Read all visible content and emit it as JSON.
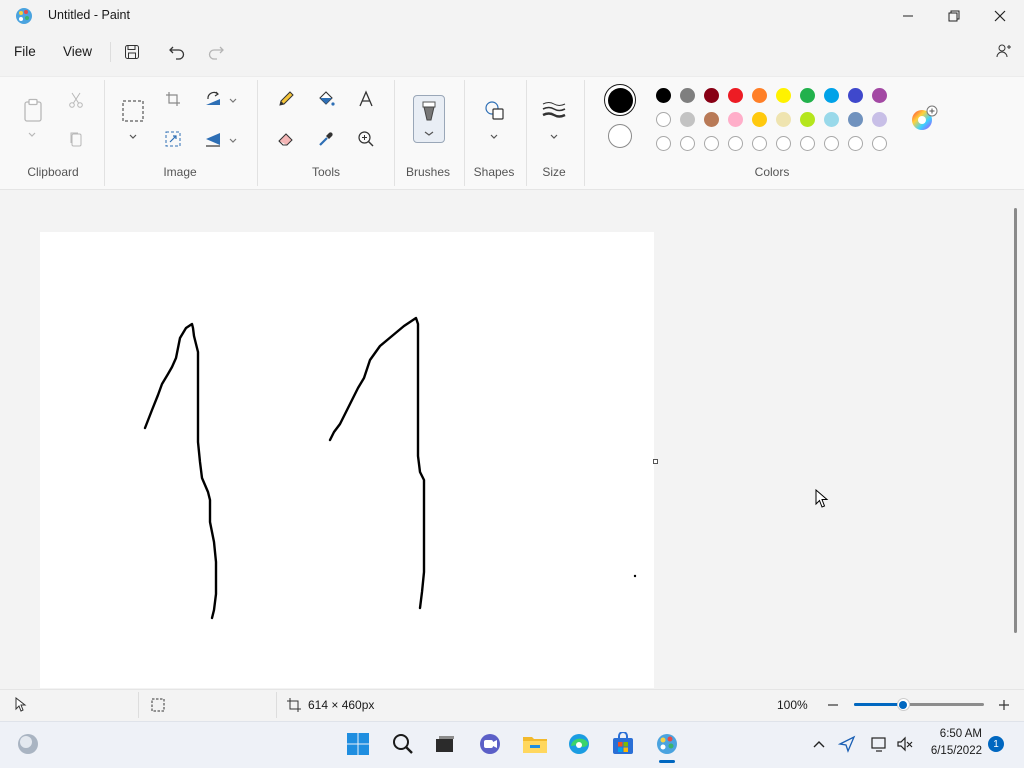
{
  "window": {
    "title": "Untitled - Paint"
  },
  "menu": {
    "file": "File",
    "view": "View"
  },
  "ribbon": {
    "groups": {
      "clipboard": "Clipboard",
      "image": "Image",
      "tools": "Tools",
      "brushes": "Brushes",
      "shapes": "Shapes",
      "size": "Size",
      "colors": "Colors"
    }
  },
  "colors": {
    "primary": "#000000",
    "secondary": "#ffffff",
    "palette_row1": [
      "#000000",
      "#7f7f7f",
      "#880015",
      "#ed1c24",
      "#ff7f27",
      "#fff200",
      "#22b14c",
      "#00a2e8",
      "#3f48cc",
      "#a349a4"
    ],
    "palette_row2": [
      "#ffffff",
      "#c3c3c3",
      "#b97a57",
      "#ffaec9",
      "#ffc90e",
      "#efe4b0",
      "#b5e61d",
      "#99d9ea",
      "#7092be",
      "#c8bfe7"
    ]
  },
  "status": {
    "canvas_size": "614 × 460px",
    "zoom": "100%",
    "zoom_level": 0.38
  },
  "taskbar": {
    "time": "6:50 AM",
    "date": "6/15/2022",
    "notification_count": "1"
  }
}
